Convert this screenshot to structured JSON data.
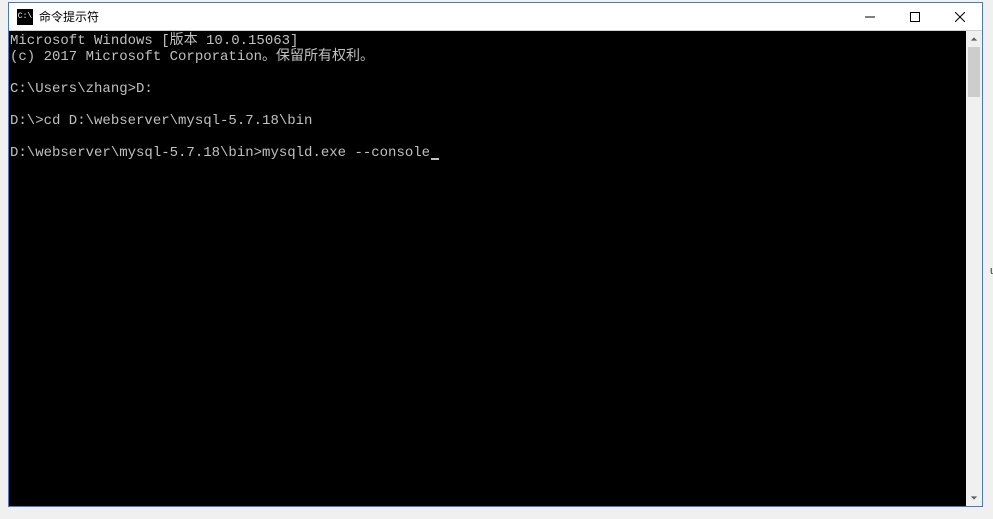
{
  "window": {
    "title": "命令提示符",
    "icon_label": "C:\\"
  },
  "console": {
    "lines": [
      "Microsoft Windows [版本 10.0.15063]",
      "(c) 2017 Microsoft Corporation。保留所有权利。",
      "",
      "C:\\Users\\zhang>D:",
      "",
      "D:\\>cd D:\\webserver\\mysql-5.7.18\\bin",
      "",
      "D:\\webserver\\mysql-5.7.18\\bin>mysqld.exe --console"
    ]
  }
}
